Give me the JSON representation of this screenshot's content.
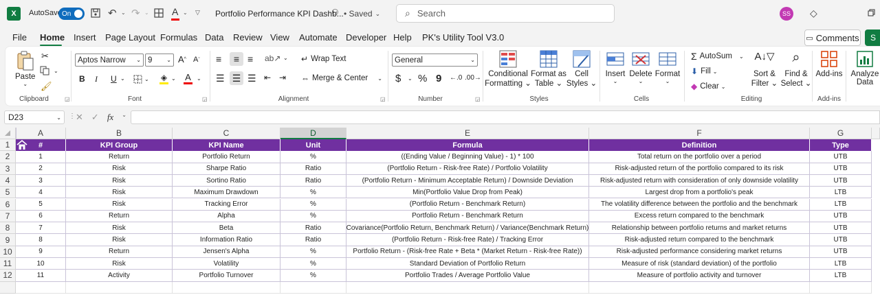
{
  "titlebar": {
    "autosave_label": "AutoSave",
    "autosave_state": "On",
    "doc_title": "Portfolio Performance KPI Dashb...",
    "saved_status": "Saved",
    "search_placeholder": "Search",
    "user_initials": "SS"
  },
  "menu": {
    "items": [
      "File",
      "Home",
      "Insert",
      "Page Layout",
      "Formulas",
      "Data",
      "Review",
      "View",
      "Automate",
      "Developer",
      "Help",
      "PK's Utility Tool V3.0"
    ],
    "active": "Home",
    "comments_label": "Comments",
    "share_label": "S"
  },
  "ribbon": {
    "clipboard": {
      "paste": "Paste",
      "group": "Clipboard"
    },
    "font": {
      "name": "Aptos Narrow",
      "size": "9",
      "bold": "B",
      "italic": "I",
      "underline": "U",
      "group": "Font"
    },
    "alignment": {
      "wrap_text": "Wrap Text",
      "merge_center": "Merge & Center",
      "group": "Alignment"
    },
    "number": {
      "format": "General",
      "currency": "$",
      "percent": "%",
      "comma": "9",
      "group": "Number"
    },
    "styles": {
      "conditional_1": "Conditional",
      "conditional_2": "Formatting",
      "format_table_1": "Format as",
      "format_table_2": "Table",
      "cell_styles_1": "Cell",
      "cell_styles_2": "Styles",
      "group": "Styles"
    },
    "cells": {
      "insert": "Insert",
      "delete": "Delete",
      "format": "Format",
      "group": "Cells"
    },
    "editing": {
      "autosum": "AutoSum",
      "fill": "Fill",
      "clear": "Clear",
      "sort_filter_1": "Sort &",
      "sort_filter_2": "Filter",
      "find_select_1": "Find &",
      "find_select_2": "Select",
      "group": "Editing"
    },
    "addins": {
      "label": "Add-ins",
      "group": "Add-ins"
    },
    "analyze": {
      "label_1": "Analyze",
      "label_2": "Data"
    }
  },
  "formula_bar": {
    "name_box": "D23",
    "fx": "fx",
    "formula": ""
  },
  "sheet": {
    "selected_column": "D",
    "columns": [
      "A",
      "B",
      "C",
      "D",
      "E",
      "F",
      "G"
    ],
    "rows": [
      "1",
      "2",
      "3",
      "4",
      "5",
      "6",
      "7",
      "8",
      "9",
      "10",
      "11",
      "12"
    ],
    "header": [
      "#",
      "KPI Group",
      "KPI Name",
      "Unit",
      "Formula",
      "Definition",
      "Type"
    ],
    "data": [
      [
        "1",
        "Return",
        "Portfolio Return",
        "%",
        "((Ending Value / Beginning Value) - 1) * 100",
        "Total return on the portfolio over a period",
        "UTB"
      ],
      [
        "2",
        "Risk",
        "Sharpe Ratio",
        "Ratio",
        "(Portfolio Return - Risk-free Rate) / Portfolio Volatility",
        "Risk-adjusted return of the portfolio compared to its risk",
        "UTB"
      ],
      [
        "3",
        "Risk",
        "Sortino Ratio",
        "Ratio",
        "(Portfolio Return - Minimum Acceptable Return) / Downside Deviation",
        "Risk-adjusted return with consideration of only downside volatility",
        "UTB"
      ],
      [
        "4",
        "Risk",
        "Maximum Drawdown",
        "%",
        "Min(Portfolio Value Drop from Peak)",
        "Largest drop from a portfolio's peak",
        "LTB"
      ],
      [
        "5",
        "Risk",
        "Tracking Error",
        "%",
        "(Portfolio Return - Benchmark Return)",
        "The volatility difference between the portfolio and the benchmark",
        "LTB"
      ],
      [
        "6",
        "Return",
        "Alpha",
        "%",
        "Portfolio Return - Benchmark Return",
        "Excess return compared to the benchmark",
        "UTB"
      ],
      [
        "7",
        "Risk",
        "Beta",
        "Ratio",
        "Covariance(Portfolio Return, Benchmark Return) / Variance(Benchmark Return)",
        "Relationship between portfolio returns and market returns",
        "UTB"
      ],
      [
        "8",
        "Risk",
        "Information Ratio",
        "Ratio",
        "(Portfolio Return - Risk-free Rate) / Tracking Error",
        "Risk-adjusted return compared to the benchmark",
        "UTB"
      ],
      [
        "9",
        "Return",
        "Jensen's Alpha",
        "%",
        "Portfolio Return - (Risk-free Rate + Beta * (Market Return - Risk-free Rate))",
        "Risk-adjusted performance considering market returns",
        "UTB"
      ],
      [
        "10",
        "Risk",
        "Volatility",
        "%",
        "Standard Deviation of Portfolio Return",
        "Measure of risk (standard deviation) of the portfolio",
        "LTB"
      ],
      [
        "11",
        "Activity",
        "Portfolio Turnover",
        "%",
        "Portfolio Trades / Average Portfolio Value",
        "Measure of portfolio activity and turnover",
        "LTB"
      ]
    ],
    "colors": {
      "header_bg": "#7030a0",
      "header_text": "#ffffff",
      "grid": "#c9c3d8",
      "excel_green": "#107c41"
    }
  }
}
